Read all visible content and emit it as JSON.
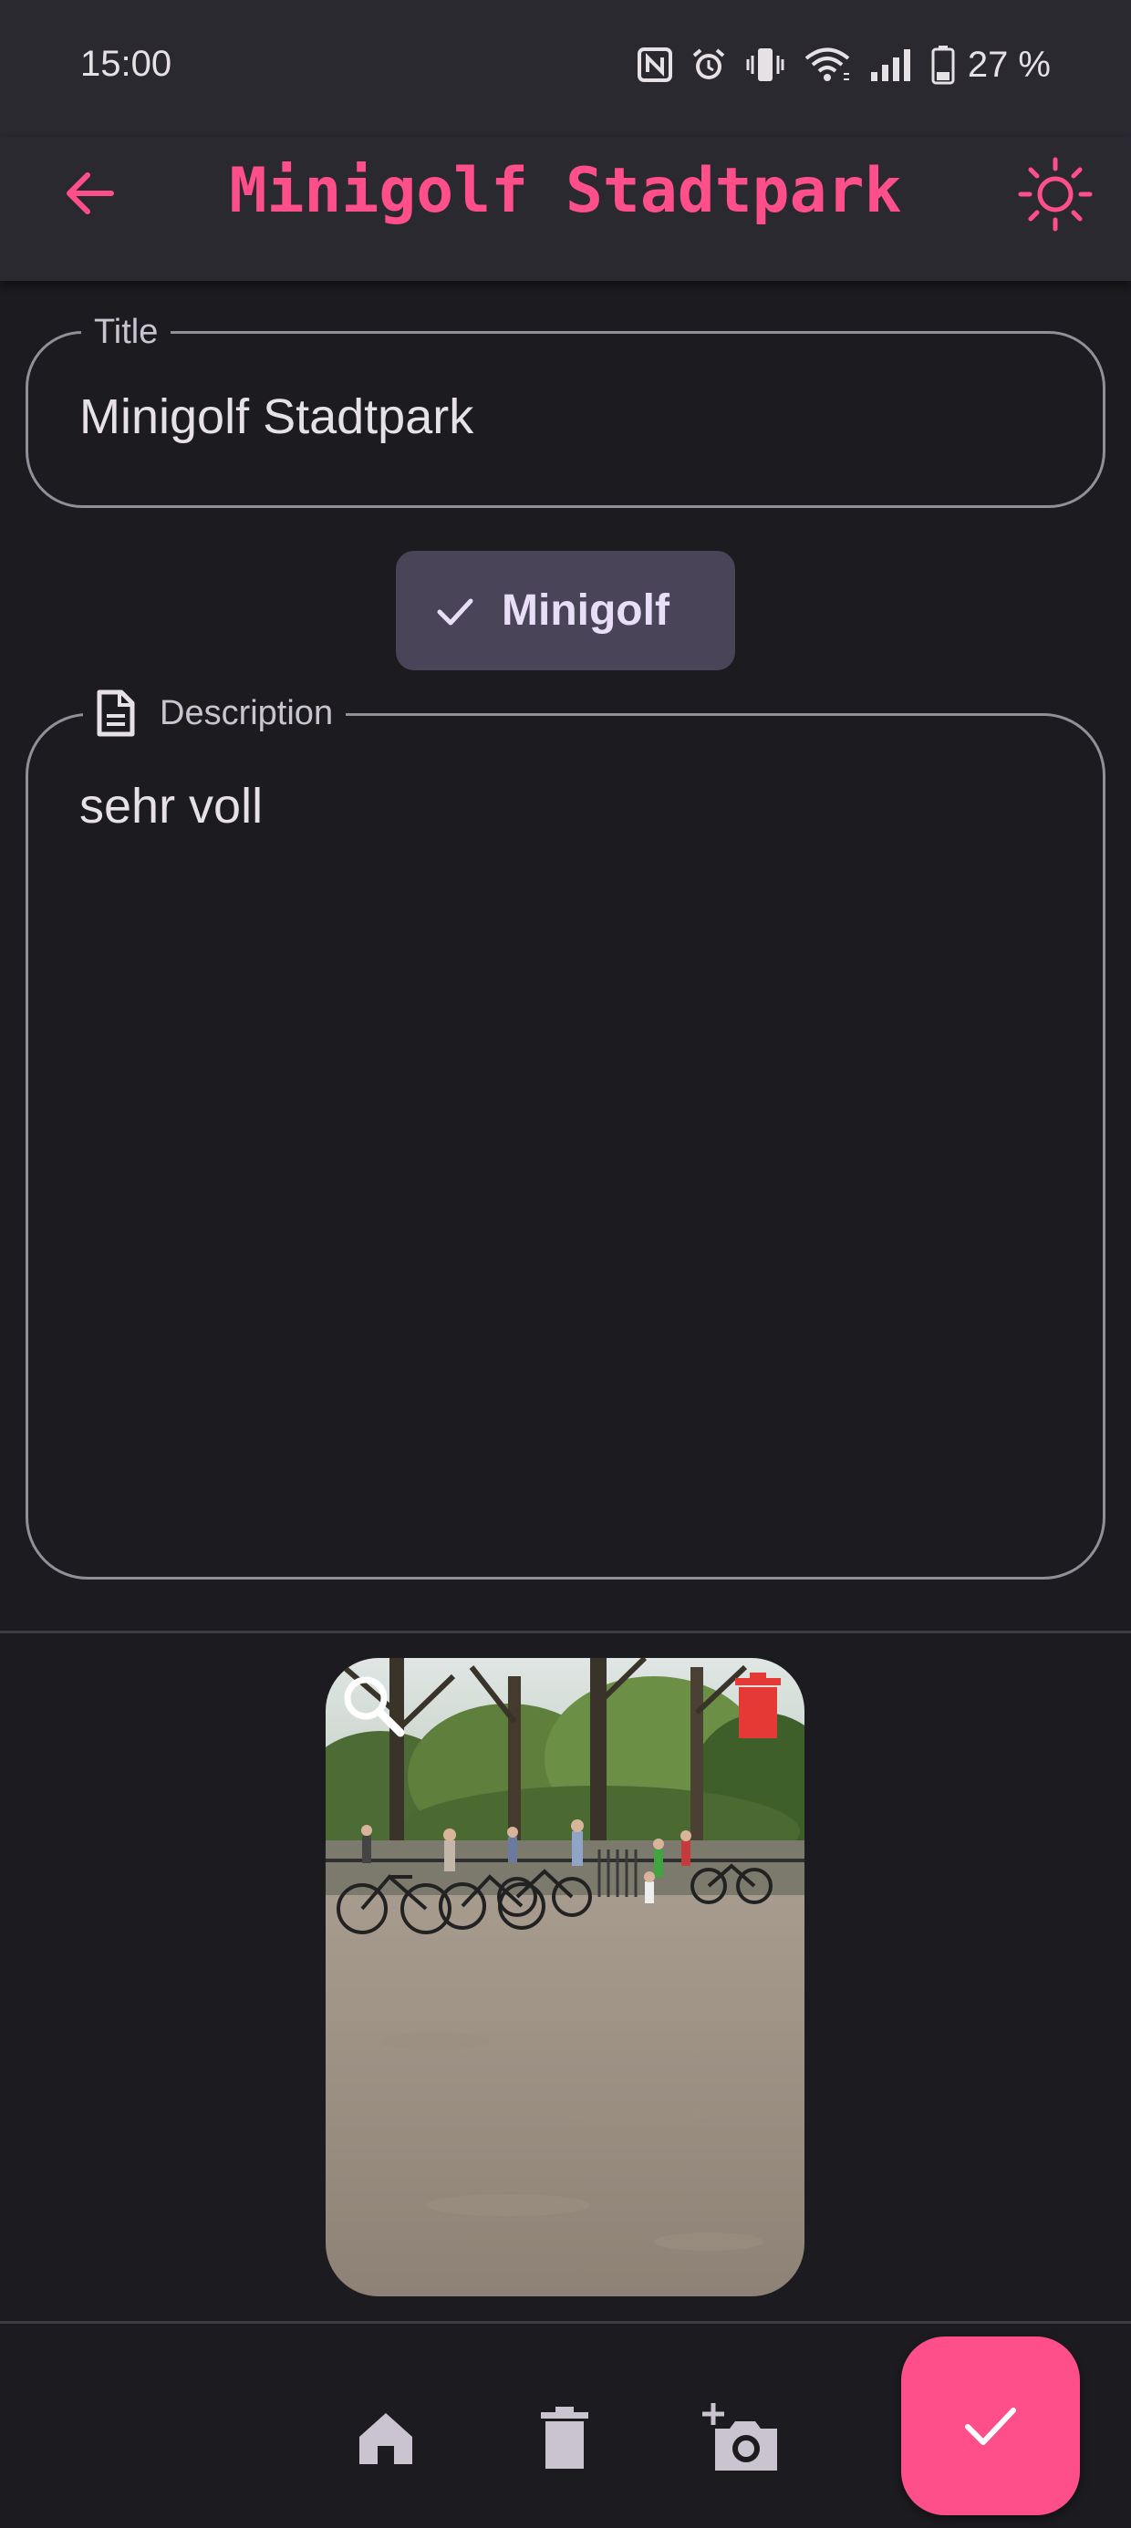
{
  "status_bar": {
    "time": "15:00",
    "battery": "27 %",
    "icons": [
      "nfc-icon",
      "alarm-icon",
      "vibrate-icon",
      "wifi-icon",
      "signal-icon",
      "battery-icon"
    ]
  },
  "app_bar": {
    "title": "Minigolf Stadtpark",
    "back_icon": "arrow-left-icon",
    "theme_icon": "sun-icon"
  },
  "form": {
    "title_label": "Title",
    "title_value": "Minigolf Stadtpark",
    "category_chip": {
      "label": "Minigolf",
      "selected": true
    },
    "description_label": "Description",
    "description_value": "sehr voll"
  },
  "photo": {
    "overlay_icons": [
      "zoom-icon",
      "delete-icon"
    ]
  },
  "bottom_bar": {
    "actions": [
      "home-icon",
      "trash-icon",
      "add-photo-icon"
    ],
    "fab_icon": "check-icon"
  },
  "colors": {
    "accent": "#ff4f8b",
    "background": "#1c1b1f",
    "surface": "#2b2930",
    "chip": "#4a4458",
    "delete": "#e53935"
  }
}
